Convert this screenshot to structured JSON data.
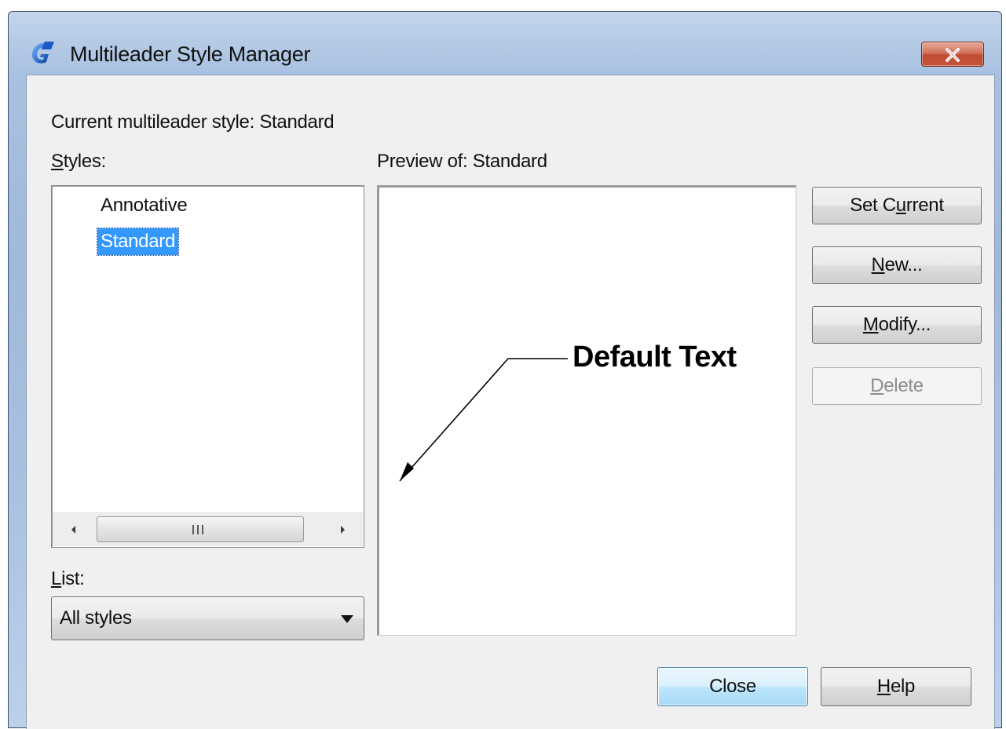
{
  "window": {
    "title": "Multileader Style Manager",
    "close_icon": "close-x-icon"
  },
  "current_style_label": "Current multileader style: Standard",
  "styles": {
    "label": "Styles:",
    "items": [
      {
        "label": "Annotative",
        "selected": false
      },
      {
        "label": "Standard",
        "selected": true
      }
    ],
    "scrollbar_grip": "III"
  },
  "list": {
    "label": "List:",
    "value": "All styles"
  },
  "preview": {
    "label": "Preview of: Standard",
    "sample_text": "Default Text"
  },
  "buttons": {
    "set_current": "Set Current",
    "new": "New...",
    "modify": "Modify...",
    "delete": "Delete",
    "close": "Close",
    "help": "Help"
  },
  "colors": {
    "selection": "#3399ff",
    "client_bg": "#f0f0f0",
    "close_button": "#c75038",
    "default_button_border": "#3c7fb1"
  }
}
